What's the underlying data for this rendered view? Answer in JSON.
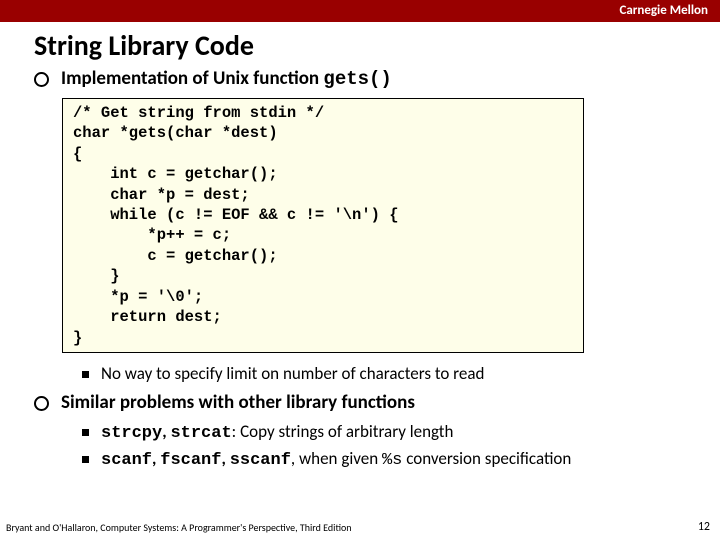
{
  "header": {
    "brand": "Carnegie Mellon"
  },
  "title": "String Library Code",
  "bullets": {
    "b1_prefix": "Implementation of Unix function ",
    "b1_code": "gets()",
    "b2": "Similar problems with other library functions"
  },
  "code": "/* Get string from stdin */\nchar *gets(char *dest)\n{\n    int c = getchar();\n    char *p = dest;\n    while (c != EOF && c != '\\n') {\n        *p++ = c;\n        c = getchar();\n    }\n    *p = '\\0';\n    return dest;\n}",
  "sub": {
    "s1": "No way to specify limit on number of characters to read",
    "s2a": "strcpy",
    "s2b": "strcat",
    "s2c": ": Copy strings of arbitrary length",
    "s3a": "scanf",
    "s3b": "fscanf",
    "s3c": "sscanf",
    "s3d": ", when given ",
    "s3e": "%s",
    "s3f": " conversion specification"
  },
  "footer": "Bryant and O'Hallaron, Computer Systems: A Programmer's Perspective, Third Edition",
  "page": "12"
}
